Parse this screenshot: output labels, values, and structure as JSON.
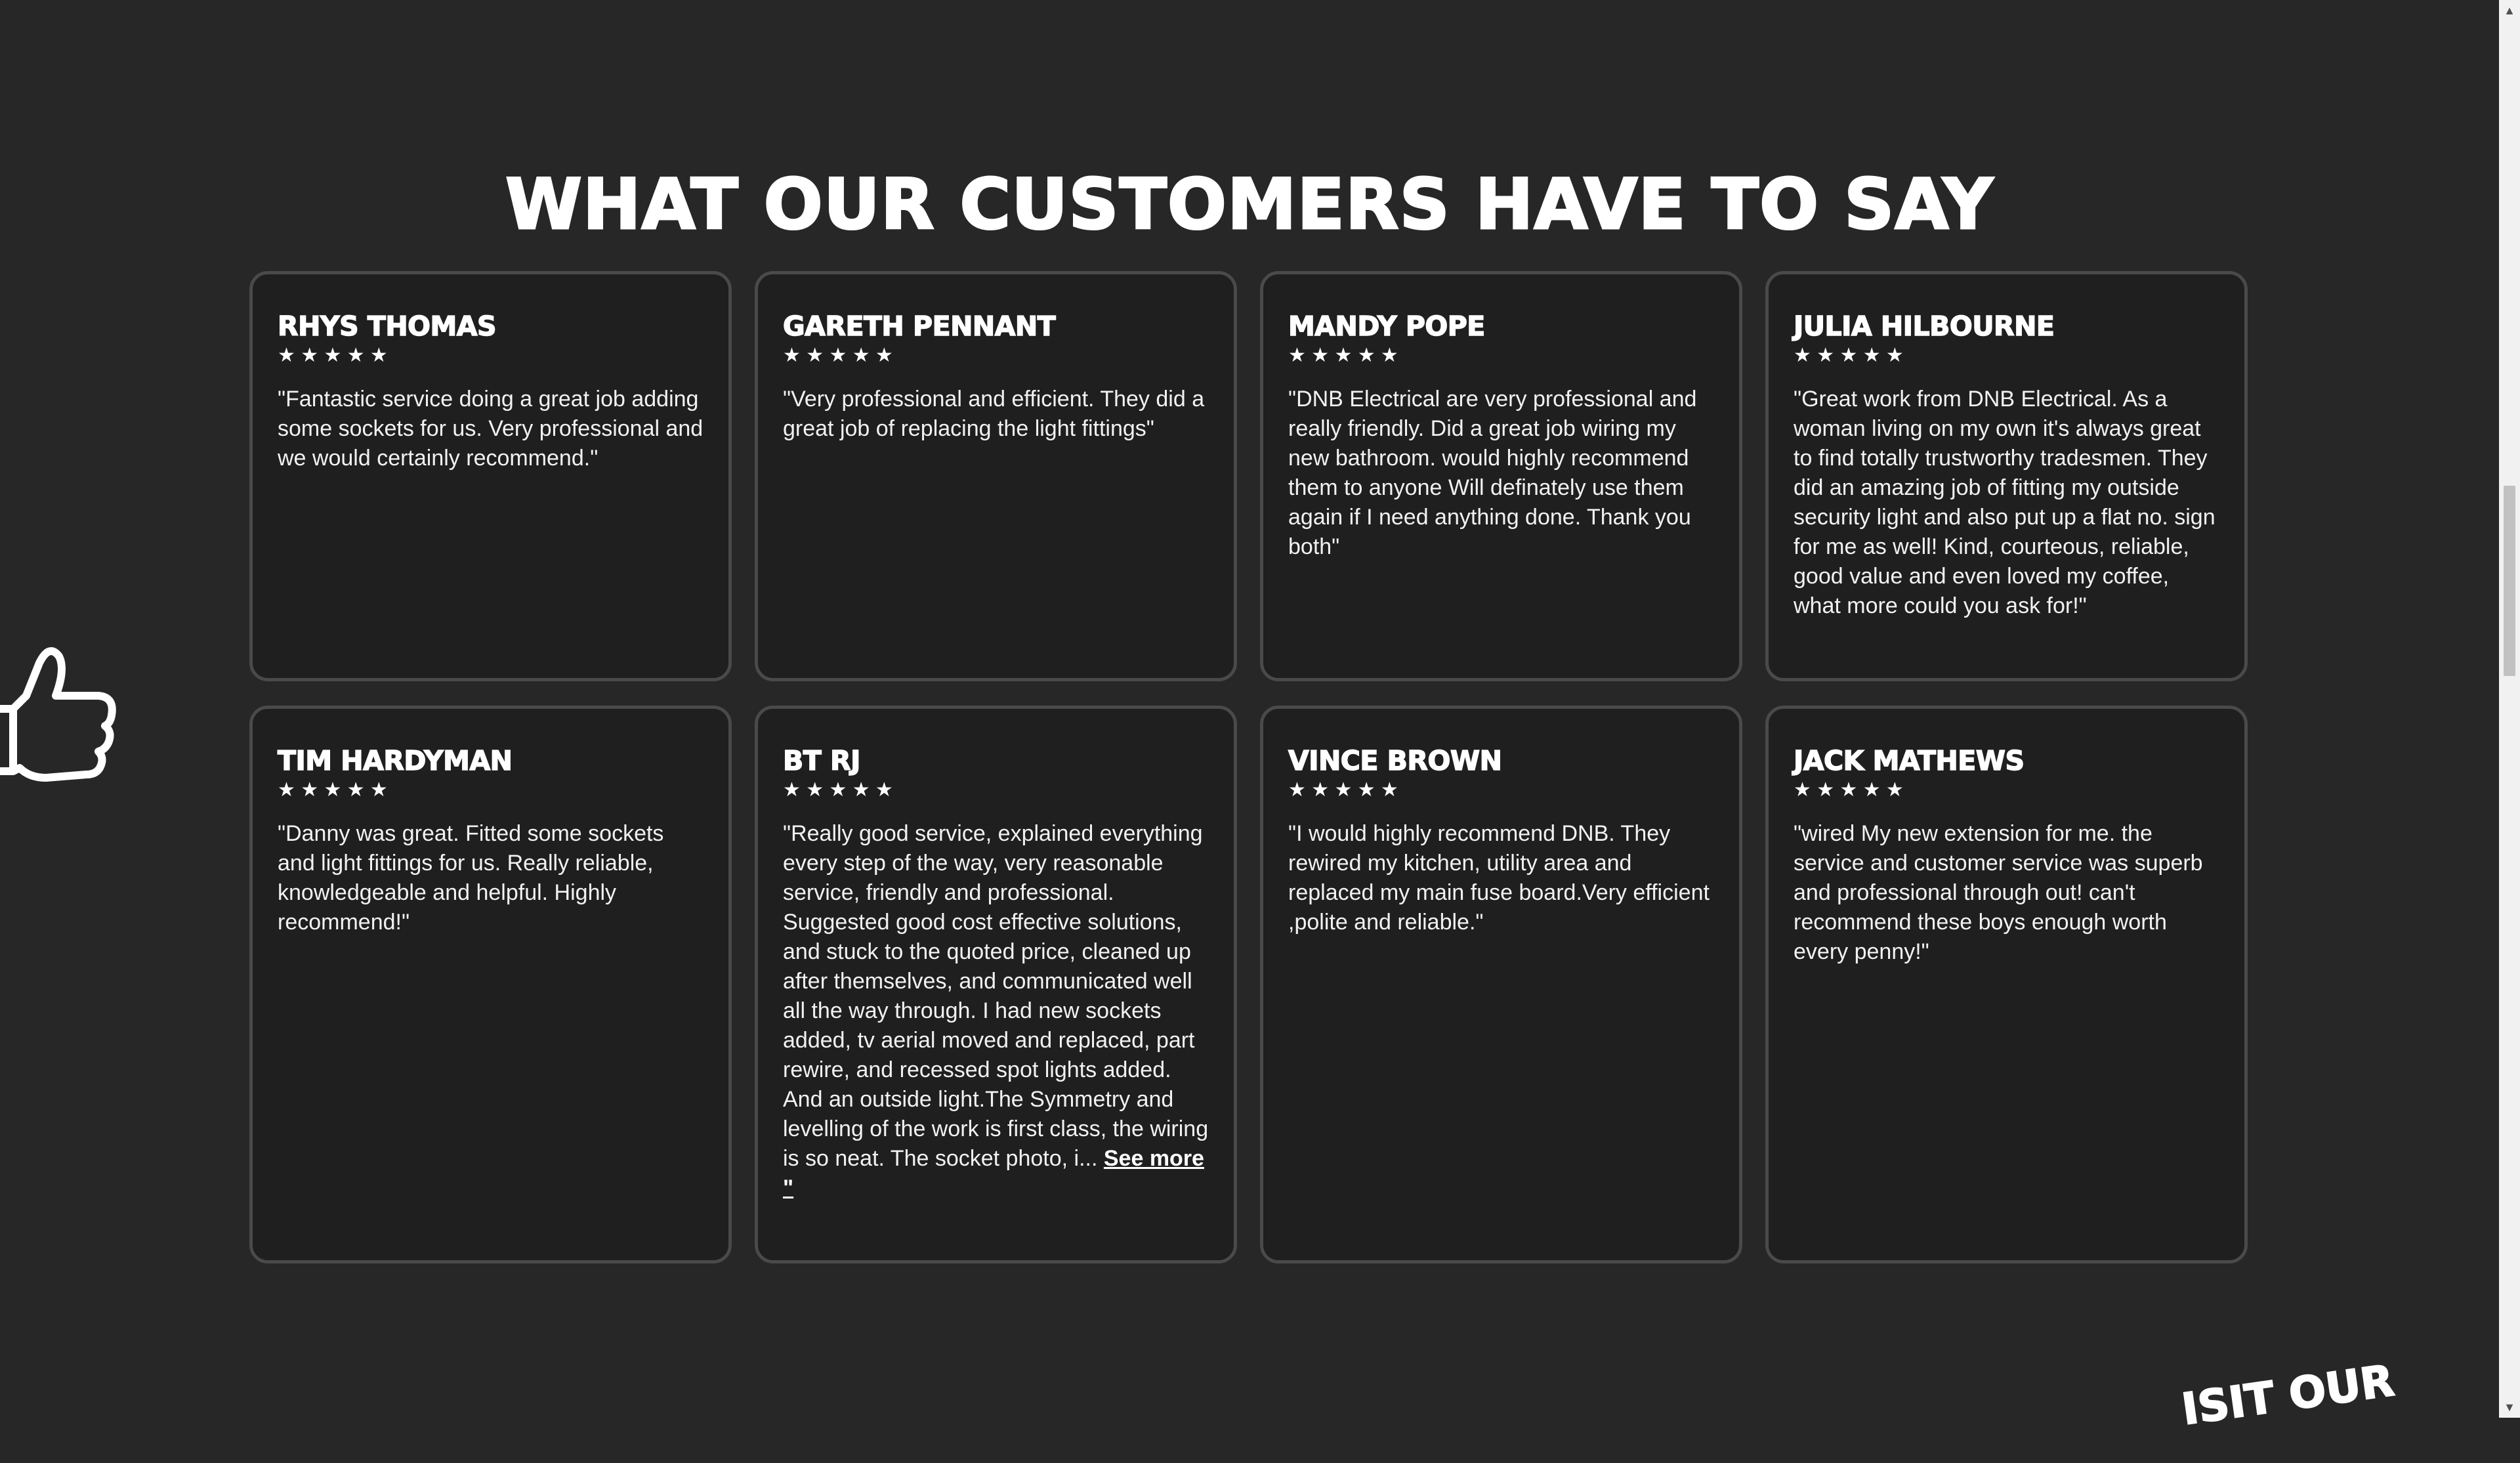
{
  "section": {
    "title": "WHAT OUR CUSTOMERS HAVE TO SAY"
  },
  "reviews": [
    {
      "name": "RHYS THOMAS",
      "rating": 5,
      "stars": "★ ★ ★ ★ ★",
      "text": "\"Fantastic service doing a great job adding some sockets for us. Very professional and we would certainly recommend.\""
    },
    {
      "name": "GARETH PENNANT",
      "rating": 5,
      "stars": "★ ★ ★ ★ ★",
      "text": "\"Very professional and efficient. They did a great job of replacing the light fittings\""
    },
    {
      "name": "MANDY POPE",
      "rating": 5,
      "stars": "★ ★ ★ ★ ★",
      "text": "\"DNB Electrical are  very professional and really friendly. Did a great job wiring my new bathroom. would highly recommend them to anyone   Will definately use them again if I need anything done. Thank you both\""
    },
    {
      "name": "JULIA HILBOURNE",
      "rating": 5,
      "stars": "★ ★ ★ ★ ★",
      "text": "\"Great work from DNB Electrical. As a woman living on my own it's always great to find totally trustworthy tradesmen. They did an amazing job of fitting my outside security light and also put up a flat no. sign for me as well! Kind, courteous, reliable, good value and even loved my coffee, what more could you ask for!\""
    },
    {
      "name": "TIM HARDYMAN",
      "rating": 5,
      "stars": "★ ★ ★ ★ ★",
      "text": "\"Danny was great. Fitted some sockets and light fittings for us. Really reliable, knowledgeable and helpful. Highly recommend!\""
    },
    {
      "name": "BT RJ",
      "rating": 5,
      "stars": "★ ★ ★ ★ ★",
      "text": "\"Really good service, explained everything every step of the way, very reasonable service, friendly and professional. Suggested good cost effective solutions, and stuck to the quoted price, cleaned up after themselves, and communicated well all the way through. I had new sockets added, tv aerial moved and replaced, part rewire, and recessed spot lights added. And an outside light.The Symmetry and levelling of the work is first class, the wiring is so neat. The socket photo, i... ",
      "see_more": "See more \""
    },
    {
      "name": "VINCE BROWN",
      "rating": 5,
      "stars": "★ ★ ★ ★ ★",
      "text": "\"I would highly recommend  DNB. They rewired my kitchen, utility area  and replaced my main fuse board.Very efficient ,polite and reliable.\""
    },
    {
      "name": "JACK MATHEWS",
      "rating": 5,
      "stars": "★ ★ ★ ★ ★",
      "text": "\"wired My new extension for me. the service and customer service was superb and professional through out! can't recommend these boys enough worth every penny!\""
    }
  ],
  "next_section_partial_title": "ISIT OUR",
  "icons": {
    "thumb": "thumbs-up-icon",
    "star": "star-icon",
    "scroll_up": "chevron-up-icon",
    "scroll_down": "chevron-down-icon"
  },
  "colors": {
    "background": "#272727",
    "card_background": "#1f1f1f",
    "card_border": "#4a4a4a",
    "text": "#ffffff"
  }
}
